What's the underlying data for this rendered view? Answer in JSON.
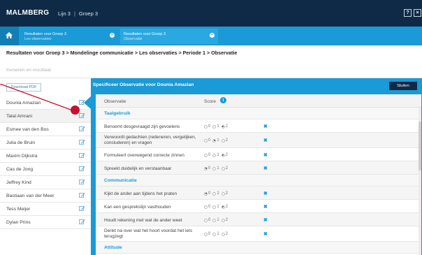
{
  "app": {
    "brand": "MALMBERG",
    "breadcrumbs": [
      "Lijn 3",
      "Groep 3"
    ],
    "help_label": "?",
    "close_label": "×"
  },
  "tabs": [
    {
      "line1": "Resultaten voor Groep 3",
      "line2": "Les observaties",
      "close": "×"
    },
    {
      "line1": "Resultaten voor Groep 3",
      "line2": "Observatie",
      "close": "×"
    }
  ],
  "page": {
    "breadcrumb": "Resultaten voor Groep 3 > Mondelinge communicatie > Les observaties > Periode 1 > Observatie",
    "filter_placeholder": "Invoeren en resultaat"
  },
  "left": {
    "download_label": "Download PDF",
    "students": [
      {
        "name": "Dounia Amazian"
      },
      {
        "name": "Talal Amrani"
      },
      {
        "name": "Esmee van den Bos"
      },
      {
        "name": "Julia de Bruin"
      },
      {
        "name": "Maxim Dijkstra"
      },
      {
        "name": "Cas de Jong"
      },
      {
        "name": "Jeffrey Kind"
      },
      {
        "name": "Bastiaan van der Meer"
      },
      {
        "name": "Tess Meijer"
      },
      {
        "name": "Dylan Prins"
      }
    ]
  },
  "panel": {
    "title": "Specificeer Observatie voor Dounia Amazian",
    "close_label": "Sluiten",
    "col_observatie": "Observatie",
    "col_score": "Score",
    "info_label": "i",
    "score_labels": [
      "0",
      "1",
      "2"
    ],
    "clear_label": "✖",
    "rows": [
      {
        "type": "section",
        "title": "Taalgebruik"
      },
      {
        "type": "item",
        "label": "Benoemt desgevraagd zijn gevoelens",
        "score": 2
      },
      {
        "type": "item",
        "label": "Verwoordt gedachten (redeneren, vergelijken, concluderen) en vragen",
        "score": 1
      },
      {
        "type": "item",
        "label": "Formuleert overwegend correcte zinnen",
        "score": 2
      },
      {
        "type": "item",
        "label": "Spreekt duidelijk en verstaanbaar",
        "score": 0
      },
      {
        "type": "section",
        "title": "Communicatie"
      },
      {
        "type": "item",
        "label": "Kijkt de ander aan tijdens het praten",
        "score": 0
      },
      {
        "type": "item",
        "label": "Kan een gesprekslijn vasthouden",
        "score": 2
      },
      {
        "type": "item",
        "label": "Houdt rekening met wat de ander weet",
        "score": null
      },
      {
        "type": "item",
        "label": "Denkt na over wat het hoort voordat het iets terugzegt",
        "score": null
      },
      {
        "type": "section",
        "title": "Attitude"
      }
    ]
  }
}
